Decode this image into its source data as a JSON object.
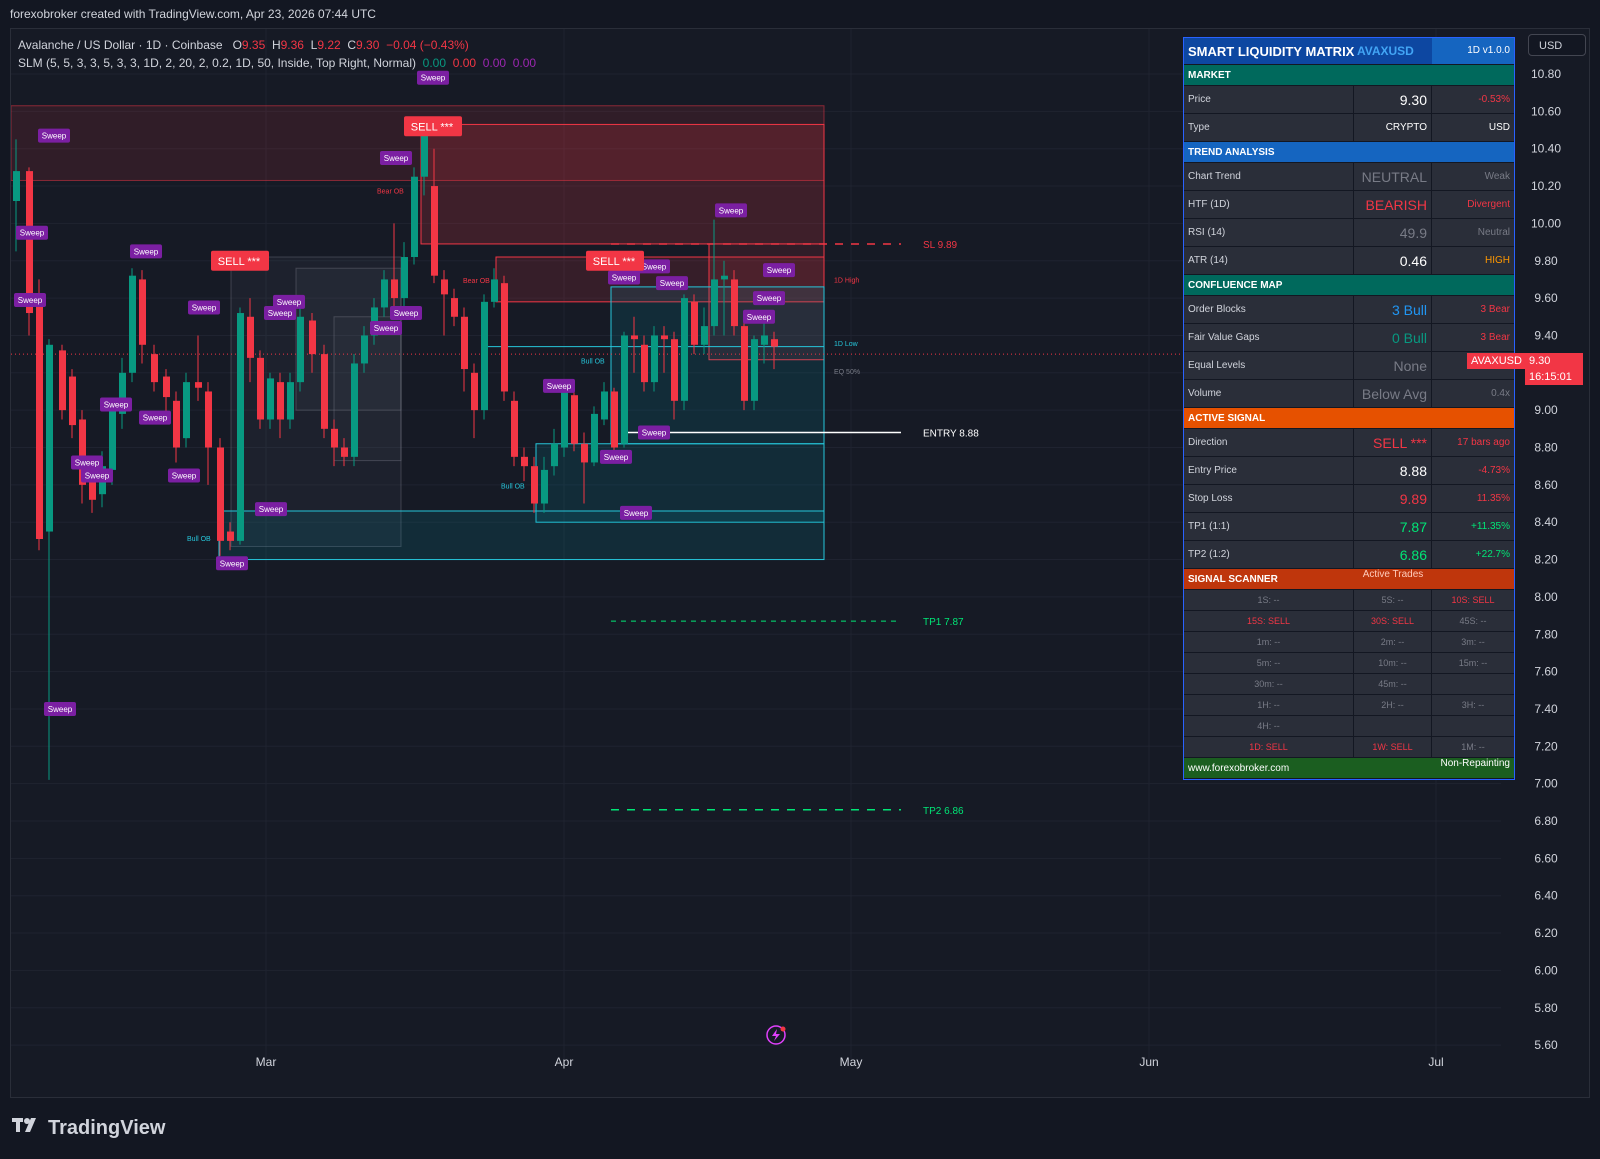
{
  "header": {
    "credit": "forexobroker created with TradingView.com, Apr 23, 2026 07:44 UTC"
  },
  "legend": {
    "symbol": "Avalanche / US Dollar · 1D · Coinbase",
    "o_label": "O",
    "o_val": "9.35",
    "h_label": "H",
    "h_val": "9.36",
    "l_label": "L",
    "l_val": "9.22",
    "c_label": "C",
    "c_val": "9.30",
    "change": "−0.04 (−0.43%)",
    "indicator": "SLM (5, 5, 3, 3, 5, 3, 3, 1D, 2, 20, 2, 0.2, 1D, 50, Inside, Top Right, Normal)",
    "ind_v1": "0.00",
    "ind_v2": "0.00",
    "ind_v3": "0.00",
    "ind_v4": "0.00"
  },
  "currency_button": "USD",
  "price_axis": [
    "10.80",
    "10.60",
    "10.40",
    "10.20",
    "10.00",
    "9.80",
    "9.60",
    "9.40",
    "9.20",
    "9.00",
    "8.80",
    "8.60",
    "8.40",
    "8.20",
    "8.00",
    "7.80",
    "7.60",
    "7.40",
    "7.20",
    "7.00",
    "6.80",
    "6.60",
    "6.40",
    "6.20",
    "6.00",
    "5.80",
    "5.60"
  ],
  "time_axis": [
    "Mar",
    "Apr",
    "May",
    "Jun",
    "Jul"
  ],
  "last_price": {
    "symbol": "AVAXUSD",
    "price": "9.30",
    "countdown": "16:15:01"
  },
  "lines": {
    "sl": "SL 9.89",
    "entry": "ENTRY 8.88",
    "tp1": "TP1 7.87",
    "tp2": "TP2 6.86",
    "d_high": "1D High",
    "d_low": "1D Low",
    "eq": "EQ 50%"
  },
  "zone_labels": {
    "bear_ob": "Bear OB",
    "bull_ob": "Bull OB",
    "sweep": "Sweep",
    "sell": "SELL ***"
  },
  "table": {
    "title": "SMART LIQUIDITY MATRIX",
    "symbol": "AVAXUSD",
    "version": "1D  v1.0.0",
    "market": "MARKET",
    "price_label": "Price",
    "price": "9.30",
    "price_chg": "-0.53%",
    "type_label": "Type",
    "type": "CRYPTO",
    "currency": "USD",
    "trend": "TREND ANALYSIS",
    "chart_trend_label": "Chart Trend",
    "chart_trend": "NEUTRAL",
    "chart_trend_s": "Weak",
    "htf_label": "HTF (1D)",
    "htf": "BEARISH",
    "htf_s": "Divergent",
    "rsi_label": "RSI (14)",
    "rsi": "49.9",
    "rsi_s": "Neutral",
    "atr_label": "ATR (14)",
    "atr": "0.46",
    "atr_s": "HIGH",
    "confluence": "CONFLUENCE MAP",
    "ob_label": "Order Blocks",
    "ob": "3 Bull",
    "ob_s": "3 Bear",
    "fvg_label": "Fair Value Gaps",
    "fvg": "0 Bull",
    "fvg_s": "3 Bear",
    "eq_label": "Equal Levels",
    "eq": "None",
    "vol_label": "Volume",
    "vol": "Below Avg",
    "vol_s": "0.4x",
    "active": "ACTIVE SIGNAL",
    "dir_label": "Direction",
    "dir": "SELL ***",
    "dir_s": "17 bars ago",
    "entry_label": "Entry Price",
    "entry": "8.88",
    "entry_s": "-4.73%",
    "sl_label": "Stop Loss",
    "sl": "9.89",
    "sl_s": "11.35%",
    "tp1_label": "TP1 (1:1)",
    "tp1": "7.87",
    "tp1_s": "+11.35%",
    "tp2_label": "TP2 (1:2)",
    "tp2": "6.86",
    "tp2_s": "+22.7%",
    "scanner": "SIGNAL SCANNER",
    "scanner_mode": "Active Trades",
    "scan": [
      [
        "1S: --",
        "5S: --",
        "10S: SELL"
      ],
      [
        "15S: SELL",
        "30S: SELL",
        "45S: --"
      ],
      [
        "1m: --",
        "2m: --",
        "3m: --"
      ],
      [
        "5m: --",
        "10m: --",
        "15m: --"
      ],
      [
        "30m: --",
        "45m: --",
        ""
      ],
      [
        "1H: --",
        "2H: --",
        "3H: --"
      ],
      [
        "4H: --",
        "",
        ""
      ],
      [
        "1D: SELL",
        "1W: SELL",
        "1M: --"
      ]
    ],
    "site": "www.forexobroker.com",
    "repaint": "Non-Repainting"
  },
  "colors": {
    "bull": "#089981",
    "bear": "#f23645",
    "sweep": "#7b1fa2",
    "accent": "#2962ff"
  },
  "footer": {
    "logo_text": "TradingView"
  }
}
